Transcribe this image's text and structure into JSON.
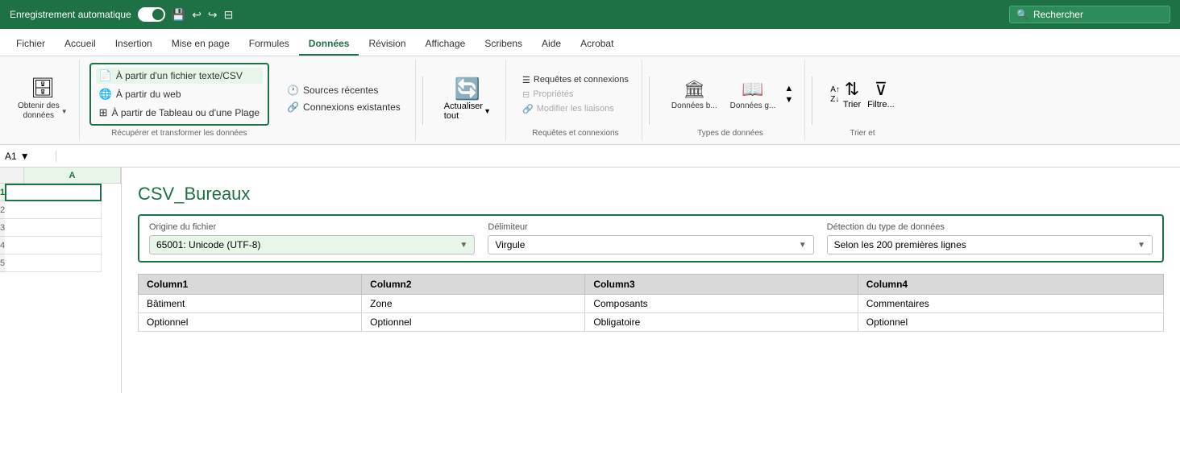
{
  "titlebar": {
    "autosave_label": "Enregistrement automatique",
    "search_placeholder": "Rechercher",
    "toggle_on": true
  },
  "ribbon": {
    "tabs": [
      {
        "label": "Fichier",
        "active": false
      },
      {
        "label": "Accueil",
        "active": false
      },
      {
        "label": "Insertion",
        "active": false
      },
      {
        "label": "Mise en page",
        "active": false
      },
      {
        "label": "Formules",
        "active": false
      },
      {
        "label": "Données",
        "active": true
      },
      {
        "label": "Révision",
        "active": false
      },
      {
        "label": "Affichage",
        "active": false
      },
      {
        "label": "Scribens",
        "active": false
      },
      {
        "label": "Aide",
        "active": false
      },
      {
        "label": "Acrobat",
        "active": false
      }
    ],
    "groups": {
      "obtenir": {
        "label": "Obtenir des\ndonnées",
        "dropdown": true
      },
      "sources": {
        "btn1": "À partir d'un fichier texte/CSV",
        "btn2": "À partir du web",
        "btn3": "À partir de Tableau ou d'une Plage"
      },
      "recentes": {
        "btn1": "Sources récentes",
        "btn2": "Connexions existantes"
      },
      "group_label_recuperer": "Récupérer et transformer les données",
      "actualiser": {
        "label1": "Actualiser",
        "label2": "tout"
      },
      "requetes": {
        "item1": "Requêtes et connexions",
        "item2": "Propriétés",
        "item3": "Modifier les liaisons"
      },
      "group_label_requetes": "Requêtes et connexions",
      "types": {
        "btn1_label": "Données b...",
        "btn2_label": "Données g..."
      },
      "group_label_types": "Types de données",
      "trier": {
        "label": "Trier"
      },
      "filtrer": {
        "label": "Filtre..."
      },
      "group_label_trier": "Trier et"
    }
  },
  "formulabar": {
    "cellref": "A1",
    "dropdown_arrow": "▼"
  },
  "spreadsheet": {
    "col_header": "A",
    "rows": [
      "1",
      "2",
      "3",
      "4",
      "5"
    ],
    "selected_row": "1",
    "selected_col": "A"
  },
  "preview": {
    "title": "CSV_Bureaux",
    "options": {
      "origine_label": "Origine du fichier",
      "origine_value": "65001: Unicode (UTF-8)",
      "delimiteur_label": "Délimiteur",
      "delimiteur_value": "Virgule",
      "detection_label": "Détection du type de données",
      "detection_value": "Selon les 200 premières lignes"
    },
    "table": {
      "headers": [
        "Column1",
        "Column2",
        "Column3",
        "Column4"
      ],
      "rows": [
        [
          "Bâtiment",
          "Zone",
          "Composants",
          "Commentaires"
        ],
        [
          "Optionnel",
          "Optionnel",
          "Obligatoire",
          "Optionnel"
        ]
      ]
    }
  },
  "icons": {
    "save": "💾",
    "undo": "↩",
    "redo": "↪",
    "search": "🔍",
    "database": "🗄",
    "globe": "🌐",
    "table": "⊞",
    "refresh": "🔄",
    "query": "☰",
    "building": "🏛",
    "book": "📖",
    "sort_az": "AZ↓",
    "sort_za": "ZA↑",
    "filter": "⊽",
    "dropdown": "▼",
    "csv_icon": "📄",
    "recent": "🕐",
    "connection": "🔗"
  }
}
